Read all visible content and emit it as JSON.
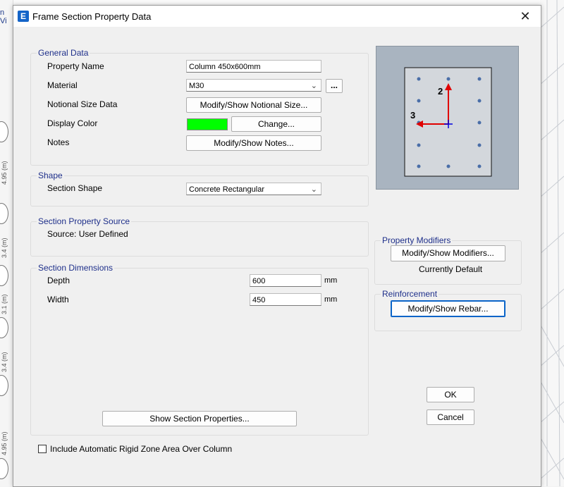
{
  "background": {
    "view_label_fragment": "n Vi",
    "axis_labels": [
      "4.95 (m)",
      "3.4 (m)",
      "3.1 (m)",
      "3.4 (m)",
      "4.95 (m)"
    ]
  },
  "dialog": {
    "app_icon_letter": "E",
    "title": "Frame Section Property Data",
    "close_glyph": "✕"
  },
  "general_data": {
    "group_title": "General Data",
    "property_name_label": "Property Name",
    "property_name_value": "Column 450x600mm",
    "material_label": "Material",
    "material_value": "M30",
    "material_more_label": "...",
    "notional_label": "Notional Size Data",
    "notional_button": "Modify/Show Notional Size...",
    "display_color_label": "Display Color",
    "display_color_value": "#00ff00",
    "change_button": "Change...",
    "notes_label": "Notes",
    "notes_button": "Modify/Show Notes..."
  },
  "shape": {
    "group_title": "Shape",
    "section_shape_label": "Section Shape",
    "section_shape_value": "Concrete Rectangular"
  },
  "source": {
    "group_title": "Section Property Source",
    "source_text": "Source:  User Defined"
  },
  "dimensions": {
    "group_title": "Section Dimensions",
    "depth_label": "Depth",
    "depth_value": "600",
    "depth_unit": "mm",
    "width_label": "Width",
    "width_value": "450",
    "width_unit": "mm"
  },
  "show_section_properties_button": "Show Section Properties...",
  "preview": {
    "axis_2_label": "2",
    "axis_3_label": "3"
  },
  "property_modifiers": {
    "group_title": "Property Modifiers",
    "button": "Modify/Show Modifiers...",
    "status": "Currently Default"
  },
  "reinforcement": {
    "group_title": "Reinforcement",
    "button": "Modify/Show Rebar..."
  },
  "ok_button": "OK",
  "cancel_button": "Cancel",
  "rigid_zone_checkbox": {
    "label": "Include Automatic Rigid Zone Area Over Column",
    "checked": false
  },
  "icons": {
    "dropdown": "chevron-down-icon",
    "close": "close-icon",
    "app": "etabs-app-icon"
  }
}
